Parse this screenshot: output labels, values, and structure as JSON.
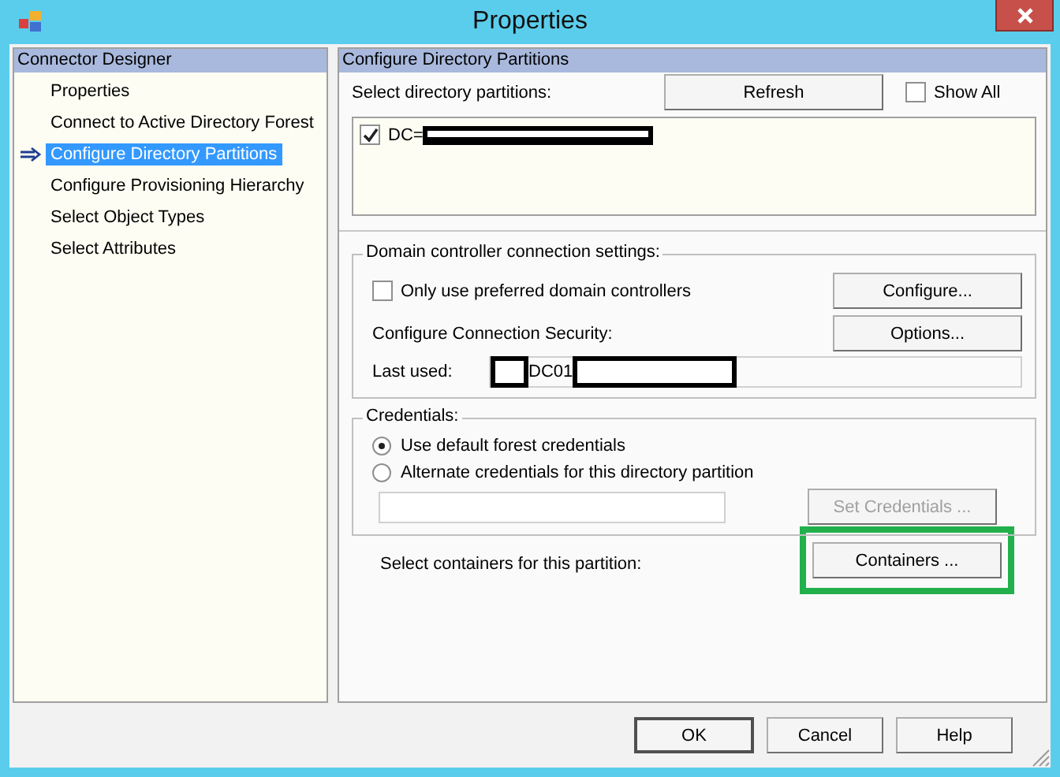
{
  "window": {
    "title": "Properties"
  },
  "sidebar": {
    "header": "Connector Designer",
    "items": [
      {
        "label": "Properties",
        "selected": false
      },
      {
        "label": "Connect to Active Directory Forest",
        "selected": false
      },
      {
        "label": "Configure Directory Partitions",
        "selected": true
      },
      {
        "label": "Configure Provisioning Hierarchy",
        "selected": false
      },
      {
        "label": "Select Object Types",
        "selected": false
      },
      {
        "label": "Select Attributes",
        "selected": false
      }
    ]
  },
  "content": {
    "header": "Configure Directory Partitions",
    "partitions_label": "Select directory partitions:",
    "refresh_button": "Refresh",
    "show_all": {
      "label": "Show All",
      "checked": false
    },
    "partitions": [
      {
        "label": "DC=",
        "checked": true
      }
    ],
    "dc_group": {
      "title": "Domain controller connection settings:",
      "preferred": {
        "label": "Only use preferred domain controllers",
        "checked": false
      },
      "configure_button": "Configure...",
      "security_label": "Configure Connection Security:",
      "options_button": "Options...",
      "last_used_label": "Last used:",
      "last_used_value": "DC01"
    },
    "credentials": {
      "title": "Credentials:",
      "options": [
        {
          "label": "Use default forest credentials",
          "selected": true
        },
        {
          "label": "Alternate credentials for this directory partition",
          "selected": false
        }
      ],
      "set_button": {
        "label": "Set Credentials ...",
        "disabled": true
      }
    },
    "containers_label": "Select containers for this partition:",
    "containers_button": "Containers ...",
    "containers_highlighted": true
  },
  "buttons": [
    "OK",
    "Cancel",
    "Help"
  ]
}
